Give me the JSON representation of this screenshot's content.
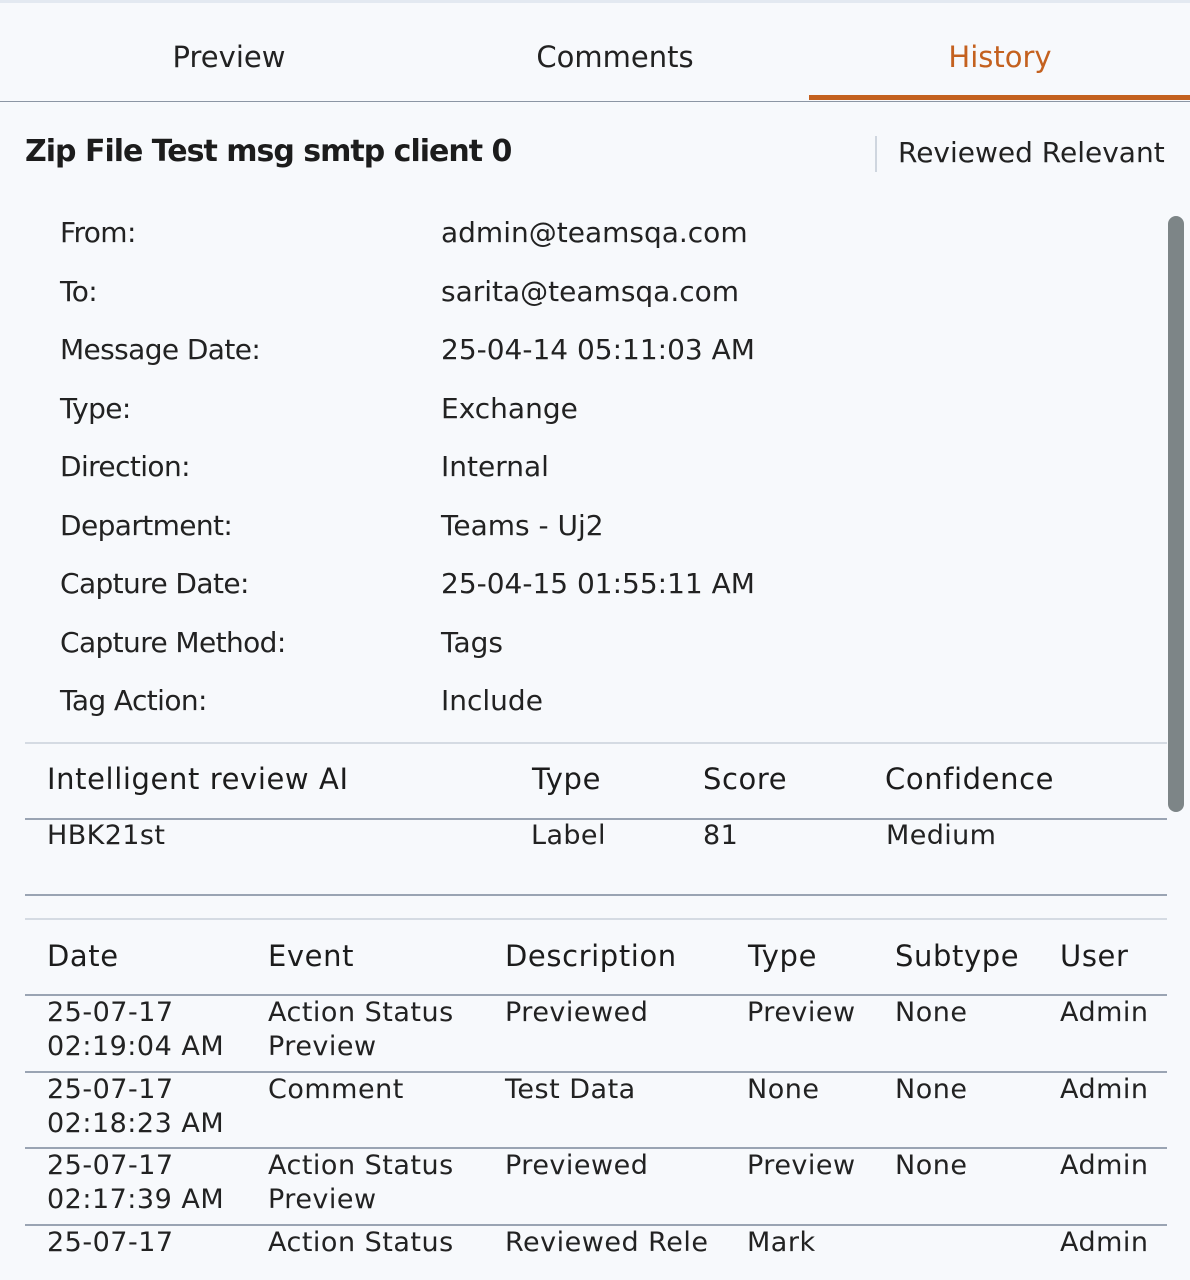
{
  "tabs": [
    {
      "label": "Preview",
      "active": false
    },
    {
      "label": "Comments",
      "active": false
    },
    {
      "label": "History",
      "active": true
    }
  ],
  "accent_color": "#c4611f",
  "message": {
    "title": "Zip File Test msg smtp client 0",
    "status": "Reviewed Relevant"
  },
  "details": [
    {
      "label": "From:",
      "value": "admin@teamsqa.com"
    },
    {
      "label": "To:",
      "value": "sarita@teamsqa.com"
    },
    {
      "label": "Message Date:",
      "value": "25-04-14 05:11:03 AM"
    },
    {
      "label": "Type:",
      "value": "Exchange"
    },
    {
      "label": "Direction:",
      "value": "Internal"
    },
    {
      "label": "Department:",
      "value": "Teams - Uj2"
    },
    {
      "label": "Capture Date:",
      "value": "25-04-15 01:55:11 AM"
    },
    {
      "label": "Capture Method:",
      "value": "Tags"
    },
    {
      "label": "Tag Action:",
      "value": "Include"
    }
  ],
  "ai_table": {
    "headers": [
      "Intelligent review AI",
      "Type",
      "Score",
      "Confidence"
    ],
    "rows": [
      [
        "HBK21st",
        "Label",
        "81",
        "Medium"
      ]
    ]
  },
  "history_table": {
    "headers": [
      "Date",
      "Event",
      "Description",
      "Type",
      "Subtype",
      "User"
    ],
    "rows": [
      {
        "date1": "25-07-17",
        "date2": "02:19:04 AM",
        "event1": "Action Status",
        "event2": "Preview",
        "description": "Previewed",
        "type": "Preview",
        "subtype": "None",
        "user": "Admin"
      },
      {
        "date1": "25-07-17",
        "date2": "02:18:23 AM",
        "event1": "Comment",
        "event2": "",
        "description": "Test Data",
        "type": "None",
        "subtype": "None",
        "user": "Admin"
      },
      {
        "date1": "25-07-17",
        "date2": "02:17:39 AM",
        "event1": "Action Status",
        "event2": "Preview",
        "description": "Previewed",
        "type": "Preview",
        "subtype": "None",
        "user": "Admin"
      },
      {
        "date1": "25-07-17",
        "date2": "",
        "event1": "Action Status",
        "event2": "",
        "description": "Reviewed Rele",
        "type": "Mark",
        "subtype": "",
        "user": "Admin"
      }
    ]
  }
}
